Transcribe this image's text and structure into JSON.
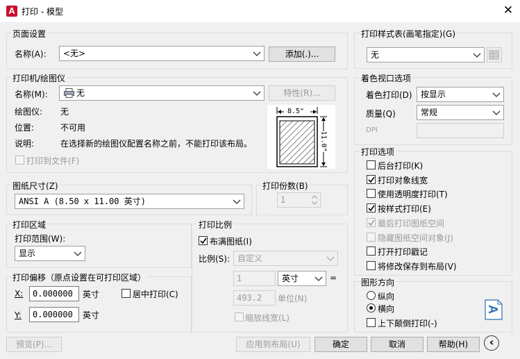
{
  "window": {
    "title": "打印 - 模型",
    "app_icon_letter": "A"
  },
  "page_setup": {
    "group_title": "页面设置",
    "name_label": "名称(A):",
    "name_value": "<无>",
    "add_button": "添加(.)..."
  },
  "printer": {
    "group_title": "打印机/绘图仪",
    "name_label": "名称(M):",
    "name_value": "无",
    "properties_button": "特性(R)...",
    "plotter_label": "绘图仪:",
    "plotter_value": "无",
    "location_label": "位置:",
    "location_value": "不可用",
    "description_label": "说明:",
    "description_value": "在选择新的绘图仪配置名称之前，不能打印该布局。",
    "print_to_file_label": "打印到文件(F)",
    "preview_width": "8.5\"",
    "preview_height": "11.0\""
  },
  "paper_size": {
    "group_title": "图纸尺寸(Z)",
    "value": "ANSI A (8.50 x 11.00 英寸)"
  },
  "copies": {
    "group_title": "打印份数(B)",
    "value": "1"
  },
  "plot_area": {
    "group_title": "打印区域",
    "range_label": "打印范围(W):",
    "range_value": "显示"
  },
  "plot_offset": {
    "group_title": "打印偏移（原点设置在可打印区域）",
    "x_label": "X:",
    "x_value": "0.000000",
    "x_unit": "英寸",
    "y_label": "Y:",
    "y_value": "0.000000",
    "y_unit": "英寸",
    "center_label": "居中打印(C)"
  },
  "plot_scale": {
    "group_title": "打印比例",
    "fit_label": "布满图纸(I)",
    "scale_label": "比例(S):",
    "scale_value": "自定义",
    "units_value1": "1",
    "units_combo": "英寸",
    "equals": "=",
    "units_value2": "493.2",
    "units_label": "单位(N)",
    "scale_lineweights_label": "缩放线宽(L)"
  },
  "plot_style_table": {
    "group_title": "打印样式表(画笔指定)(G)",
    "value": "无"
  },
  "shaded_viewport": {
    "group_title": "着色视口选项",
    "shade_label": "着色打印(D)",
    "shade_value": "按显示",
    "quality_label": "质量(Q)",
    "quality_value": "常规",
    "dpi_label": "DPI",
    "dpi_value": ""
  },
  "plot_options": {
    "group_title": "打印选项",
    "items": [
      {
        "label": "后台打印(K)",
        "checked": false,
        "disabled": false
      },
      {
        "label": "打印对象线宽",
        "checked": true,
        "disabled": false
      },
      {
        "label": "使用透明度打印(T)",
        "checked": false,
        "disabled": false
      },
      {
        "label": "按样式打印(E)",
        "checked": true,
        "disabled": false
      },
      {
        "label": "最后打印图纸空间",
        "checked": true,
        "disabled": true
      },
      {
        "label": "隐藏图纸空间对象(J)",
        "checked": false,
        "disabled": true
      },
      {
        "label": "打开打印戳记",
        "checked": false,
        "disabled": false
      },
      {
        "label": "将修改保存到布局(V)",
        "checked": false,
        "disabled": false
      }
    ]
  },
  "orientation": {
    "group_title": "图形方向",
    "portrait_label": "纵向",
    "landscape_label": "横向",
    "upside_down_label": "上下颠倒打印(-)",
    "selected": "landscape",
    "icon_letter": "A"
  },
  "buttons": {
    "preview": "预览(P)...",
    "apply": "应用到布局(U)",
    "ok": "确定",
    "cancel": "取消",
    "help": "帮助(H)",
    "expand_icon": "‹"
  }
}
